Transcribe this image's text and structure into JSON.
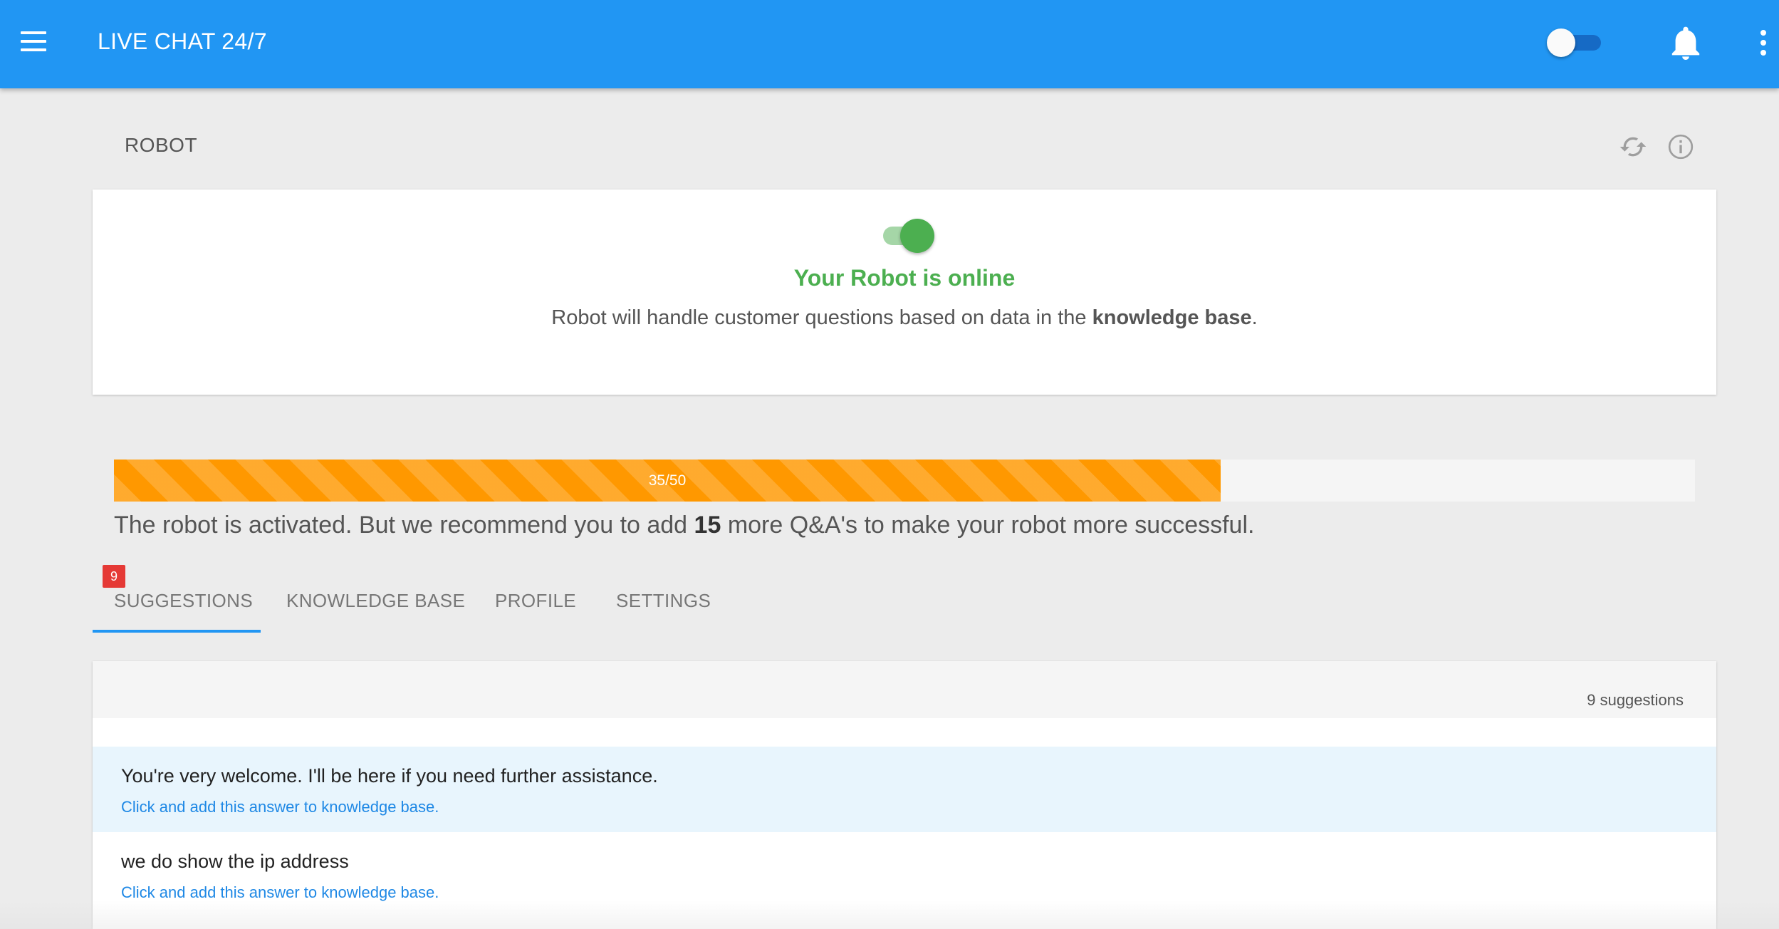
{
  "appbar": {
    "title": "LIVE CHAT 24/7",
    "menu_icon": "hamburger-menu-icon",
    "notifications_icon": "bell-icon",
    "more_icon": "more-vert-icon",
    "availability_toggle": "off"
  },
  "page": {
    "title": "ROBOT",
    "refresh_icon": "refresh-icon",
    "info_icon": "info-icon"
  },
  "status": {
    "toggle": "on",
    "title": "Your Robot is online",
    "text_before": "Robot will handle customer questions based on data in the ",
    "text_bold": "knowledge base",
    "text_after": "."
  },
  "progress": {
    "label": "35/50",
    "fraction": 0.7,
    "color": "#ff9800"
  },
  "recommendation": {
    "before": "The robot is activated. But we recommend you to add ",
    "bold": "15",
    "after": " more Q&A's to make your robot more successful."
  },
  "tabs": [
    {
      "label": "SUGGESTIONS",
      "badge": "9",
      "active": true
    },
    {
      "label": "KNOWLEDGE BASE"
    },
    {
      "label": "PROFILE"
    },
    {
      "label": "SETTINGS"
    }
  ],
  "suggestions": {
    "count_label": "9 suggestions",
    "items": [
      {
        "question": "You're very welcome. I'll be here if you need further assistance.",
        "action": "Click and add this answer to knowledge base."
      },
      {
        "question": "we do show the ip address",
        "action": "Click and add this answer to knowledge base."
      }
    ]
  },
  "colors": {
    "appbar": "#2196f3",
    "online_green": "#4caf50",
    "link_blue": "#1e88e5",
    "badge_red": "#e53935"
  }
}
